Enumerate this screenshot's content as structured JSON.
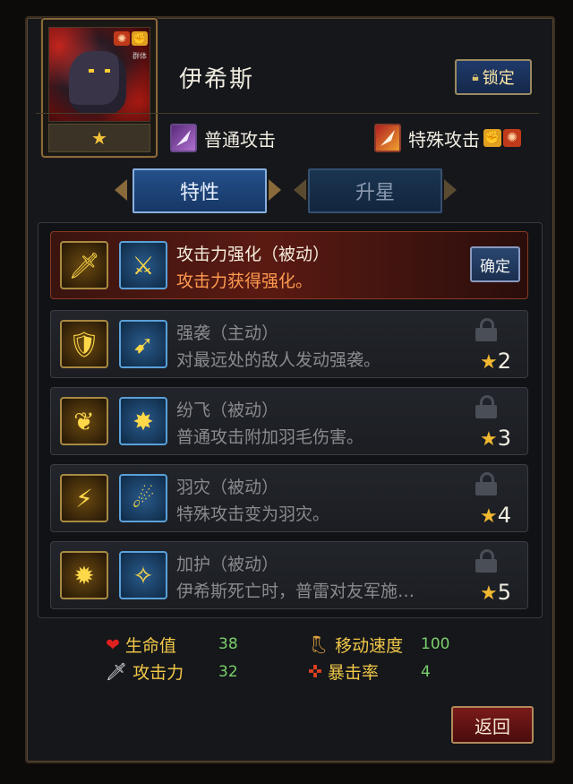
{
  "hero": {
    "name": "伊希斯",
    "star_glyph": "★",
    "lock_label": "锁定",
    "badge_text": "群体"
  },
  "attacks": {
    "normal_label": "普通攻击",
    "special_label": "特殊攻击"
  },
  "tabs": [
    {
      "label": "特性",
      "active": true
    },
    {
      "label": "升星",
      "active": false
    }
  ],
  "skills": [
    {
      "title": "攻击力强化（被动）",
      "desc": "攻击力获得强化。",
      "state": "active",
      "confirm_label": "确定",
      "icon_a": "sword-icon",
      "icon_b": "slash-icon"
    },
    {
      "title": "强袭（主动）",
      "desc": "对最远处的敌人发动强袭。",
      "state": "locked",
      "star_req": "2",
      "icon_a": "wing-shield-icon",
      "icon_b": "dash-strike-icon"
    },
    {
      "title": "纷飞（被动）",
      "desc": "普通攻击附加羽毛伤害。",
      "state": "locked",
      "star_req": "3",
      "icon_a": "feather-icon",
      "icon_b": "burst-icon"
    },
    {
      "title": "羽灾（被动）",
      "desc": "特殊攻击变为羽灾。",
      "state": "locked",
      "star_req": "4",
      "icon_a": "feather-storm-icon",
      "icon_b": "beam-icon"
    },
    {
      "title": "加护（被动）",
      "desc": "伊希斯死亡时，普雷对友军施…",
      "state": "locked",
      "star_req": "5",
      "icon_a": "dark-orb-icon",
      "icon_b": "blessing-icon"
    }
  ],
  "stats": {
    "hp_label": "生命值",
    "hp_value": "38",
    "atk_label": "攻击力",
    "atk_value": "32",
    "speed_label": "移动速度",
    "speed_value": "100",
    "crit_label": "暴击率",
    "crit_value": "4"
  },
  "return_label": "返回",
  "colors": {
    "accent_gold": "#f2c848",
    "stat_value_green": "#7ad06a",
    "active_skill_bg": "#5a1a12",
    "tab_active_blue": "#24508a"
  }
}
